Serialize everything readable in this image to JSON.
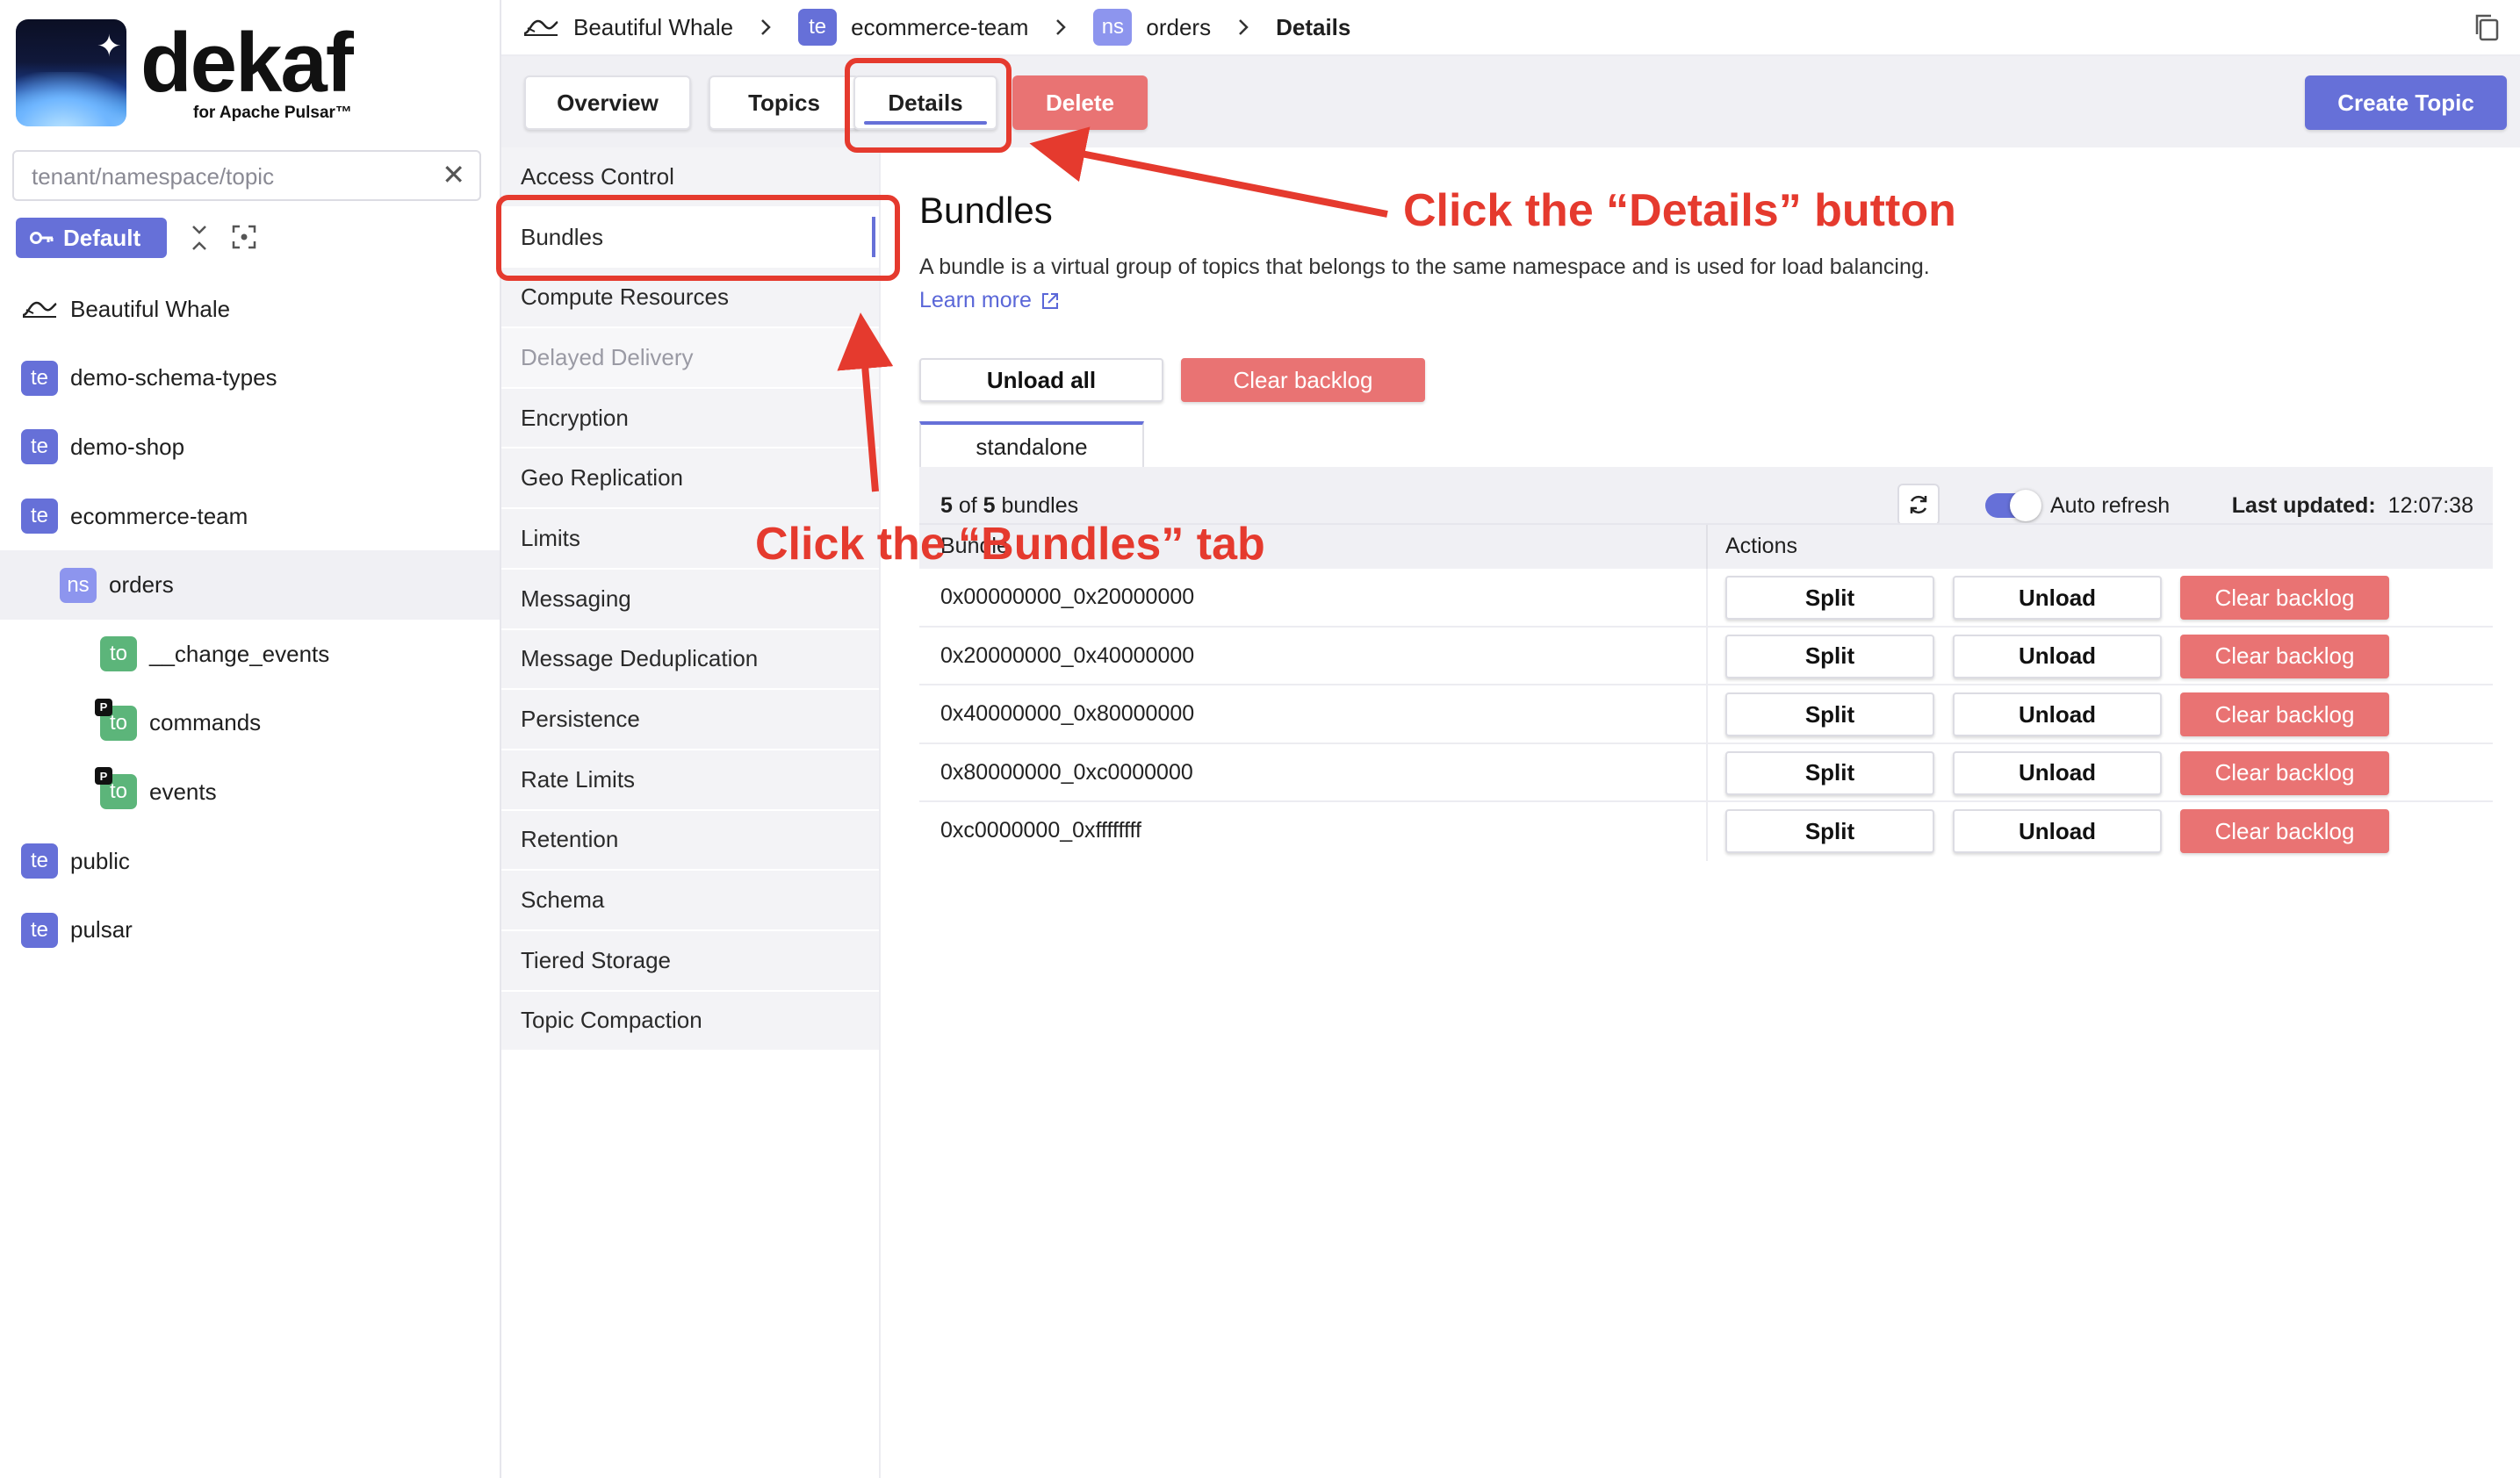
{
  "app": {
    "logo_word": "dekaf",
    "logo_sub": "for Apache Pulsar™"
  },
  "sidebar": {
    "search_placeholder": "tenant/namespace/topic",
    "default_button": "Default",
    "tree": [
      {
        "type": "instance",
        "label": "Beautiful Whale"
      },
      {
        "type": "te",
        "badge": "te",
        "label": "demo-schema-types"
      },
      {
        "type": "te",
        "badge": "te",
        "label": "demo-shop"
      },
      {
        "type": "te",
        "badge": "te",
        "label": "ecommerce-team"
      },
      {
        "type": "ns",
        "badge": "ns",
        "label": "orders"
      },
      {
        "type": "to",
        "badge": "to",
        "label": "__change_events"
      },
      {
        "type": "to",
        "badge": "to",
        "label": "commands",
        "p": "P"
      },
      {
        "type": "to",
        "badge": "to",
        "label": "events",
        "p": "P"
      },
      {
        "type": "te",
        "badge": "te",
        "label": "public"
      },
      {
        "type": "te",
        "badge": "te",
        "label": "pulsar"
      }
    ]
  },
  "breadcrumb": {
    "instance": "Beautiful Whale",
    "tenant_badge": "te",
    "tenant": "ecommerce-team",
    "namespace_badge": "ns",
    "namespace": "orders",
    "current": "Details"
  },
  "toolbar": {
    "overview": "Overview",
    "topics": "Topics",
    "details": "Details",
    "delete": "Delete",
    "create_topic": "Create Topic"
  },
  "details_nav": [
    "Access Control",
    "Bundles",
    "Compute Resources",
    "Delayed Delivery",
    "Encryption",
    "Geo Replication",
    "Limits",
    "Messaging",
    "Message Deduplication",
    "Persistence",
    "Rate Limits",
    "Retention",
    "Schema",
    "Tiered Storage",
    "Topic Compaction"
  ],
  "bundles": {
    "title": "Bundles",
    "description": "A bundle is a virtual group of topics that belongs to the same namespace and is used for load balancing.",
    "learn_more": "Learn more",
    "unload_all": "Unload all",
    "clear_backlog": "Clear backlog",
    "cluster_tab": "standalone",
    "count_shown": "5",
    "count_of": "of",
    "count_total": "5",
    "count_unit": "bundles",
    "auto_refresh": "Auto refresh",
    "last_updated_label": "Last updated:",
    "last_updated_value": "12:07:38",
    "col_bundle": "Bundle",
    "col_actions": "Actions",
    "split": "Split",
    "unload": "Unload",
    "rows": [
      "0x00000000_0x20000000",
      "0x20000000_0x40000000",
      "0x40000000_0x80000000",
      "0x80000000_0xc0000000",
      "0xc0000000_0xffffffff"
    ]
  },
  "annotations": {
    "details_hint": "Click the “Details” button",
    "bundles_hint": "Click the “Bundles” tab",
    "color": "#e53a2e"
  }
}
